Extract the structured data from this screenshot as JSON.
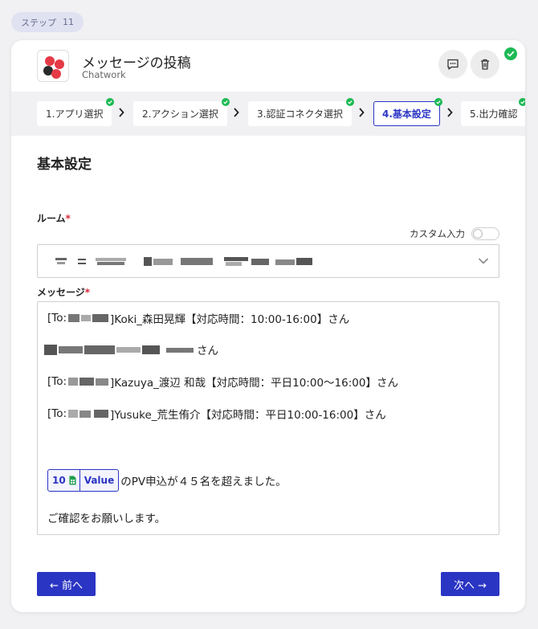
{
  "step": {
    "label": "ステップ",
    "number": "11"
  },
  "app": {
    "title": "メッセージの投稿",
    "subtitle": "Chatwork"
  },
  "colors": {
    "accent": "#2b35c4",
    "success": "#1db954",
    "required": "#d6283a"
  },
  "tabs": [
    {
      "label": "1.アプリ選択",
      "done": true
    },
    {
      "label": "2.アクション選択",
      "done": true
    },
    {
      "label": "3.認証コネクタ選択",
      "done": true
    },
    {
      "label": "4.基本設定",
      "done": true,
      "active": true
    },
    {
      "label": "5.出力確認",
      "done": true
    }
  ],
  "section": {
    "title": "基本設定"
  },
  "room": {
    "label": "ルーム",
    "required_mark": "*",
    "custom_input_label": "カスタム入力"
  },
  "message": {
    "label": "メッセージ",
    "required_mark": "*",
    "lines": {
      "l1_prefix": "[To:",
      "l1_suffix": "]Koki_森田晃輝【対応時間：10:00-16:00】さん",
      "l2_suffix": "さん",
      "l3_prefix": "[To:",
      "l3_suffix": "]Kazuya_渡辺 和哉【対応時間：平日10:00〜16:00】さん",
      "l4_prefix": "[To:",
      "l4_suffix": "]Yusuke_荒生侑介【対応時間：平日10:00-16:00】さん",
      "l5_suffix": "のPV申込が４５名を超えました。",
      "l6": "ご確認をお願いします。"
    },
    "chip": {
      "number": "10",
      "icon": "spreadsheet-icon",
      "label": "Value"
    }
  },
  "buttons": {
    "prev": "← 前へ",
    "next": "次へ →"
  }
}
